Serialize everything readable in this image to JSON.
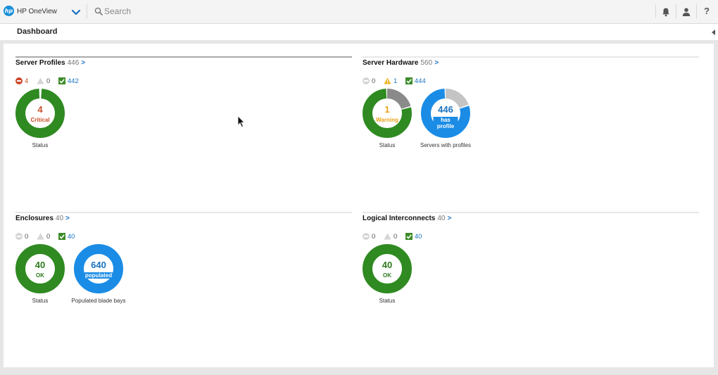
{
  "app": {
    "name": "HP OneView",
    "logo_text": "hp"
  },
  "search": {
    "placeholder": "Search"
  },
  "page": {
    "title": "Dashboard"
  },
  "help_label": "?",
  "panels": {
    "server_profiles": {
      "title": "Server Profiles",
      "count": "446",
      "chevron": ">",
      "stats": {
        "critical": "4",
        "warning": "0",
        "ok": "442"
      },
      "donuts": [
        {
          "value": "4",
          "label": "Critical",
          "caption": "Status",
          "segments": [
            {
              "fraction": 0.01,
              "color": "#e8e8e8"
            },
            {
              "fraction": 0.99,
              "color": "#2f8a21"
            }
          ],
          "value_color": "#c8502a"
        }
      ]
    },
    "server_hardware": {
      "title": "Server Hardware",
      "count": "560",
      "chevron": ">",
      "stats": {
        "disabled": "0",
        "warning": "1",
        "ok": "444"
      },
      "donuts": [
        {
          "value": "1",
          "label": "Warning",
          "caption": "Status",
          "segments": [
            {
              "fraction": 0.21,
              "color": "#8a8a8a"
            },
            {
              "fraction": 0.79,
              "color": "#2f8a21"
            }
          ],
          "value_color": "#e8a317"
        },
        {
          "value": "446",
          "label": "has profile",
          "caption": "Servers with profiles",
          "segments": [
            {
              "fraction": 0.2,
              "color": "#c4c4c4"
            },
            {
              "fraction": 0.8,
              "color": "#1a8ce6"
            }
          ],
          "value_color": "#1a73c0"
        }
      ]
    },
    "enclosures": {
      "title": "Enclosures",
      "count": "40",
      "chevron": ">",
      "stats": {
        "disabled": "0",
        "warning": "0",
        "ok": "40"
      },
      "donuts": [
        {
          "value": "40",
          "label": "OK",
          "caption": "Status",
          "segments": [
            {
              "fraction": 1,
              "color": "#2f8a21"
            }
          ],
          "value_color": "#2f7a1e"
        },
        {
          "value": "640",
          "label": "populated",
          "caption": "Populated blade bays",
          "segments": [
            {
              "fraction": 1,
              "color": "#1a8ce6"
            }
          ],
          "value_color": "#1a73c0"
        }
      ]
    },
    "logical_interconnects": {
      "title": "Logical Interconnects",
      "count": "40",
      "chevron": ">",
      "stats": {
        "disabled": "0",
        "warning": "0",
        "ok": "40"
      },
      "donuts": [
        {
          "value": "40",
          "label": "OK",
          "caption": "Status",
          "segments": [
            {
              "fraction": 1,
              "color": "#2f8a21"
            }
          ],
          "value_color": "#2f7a1e"
        }
      ]
    }
  }
}
